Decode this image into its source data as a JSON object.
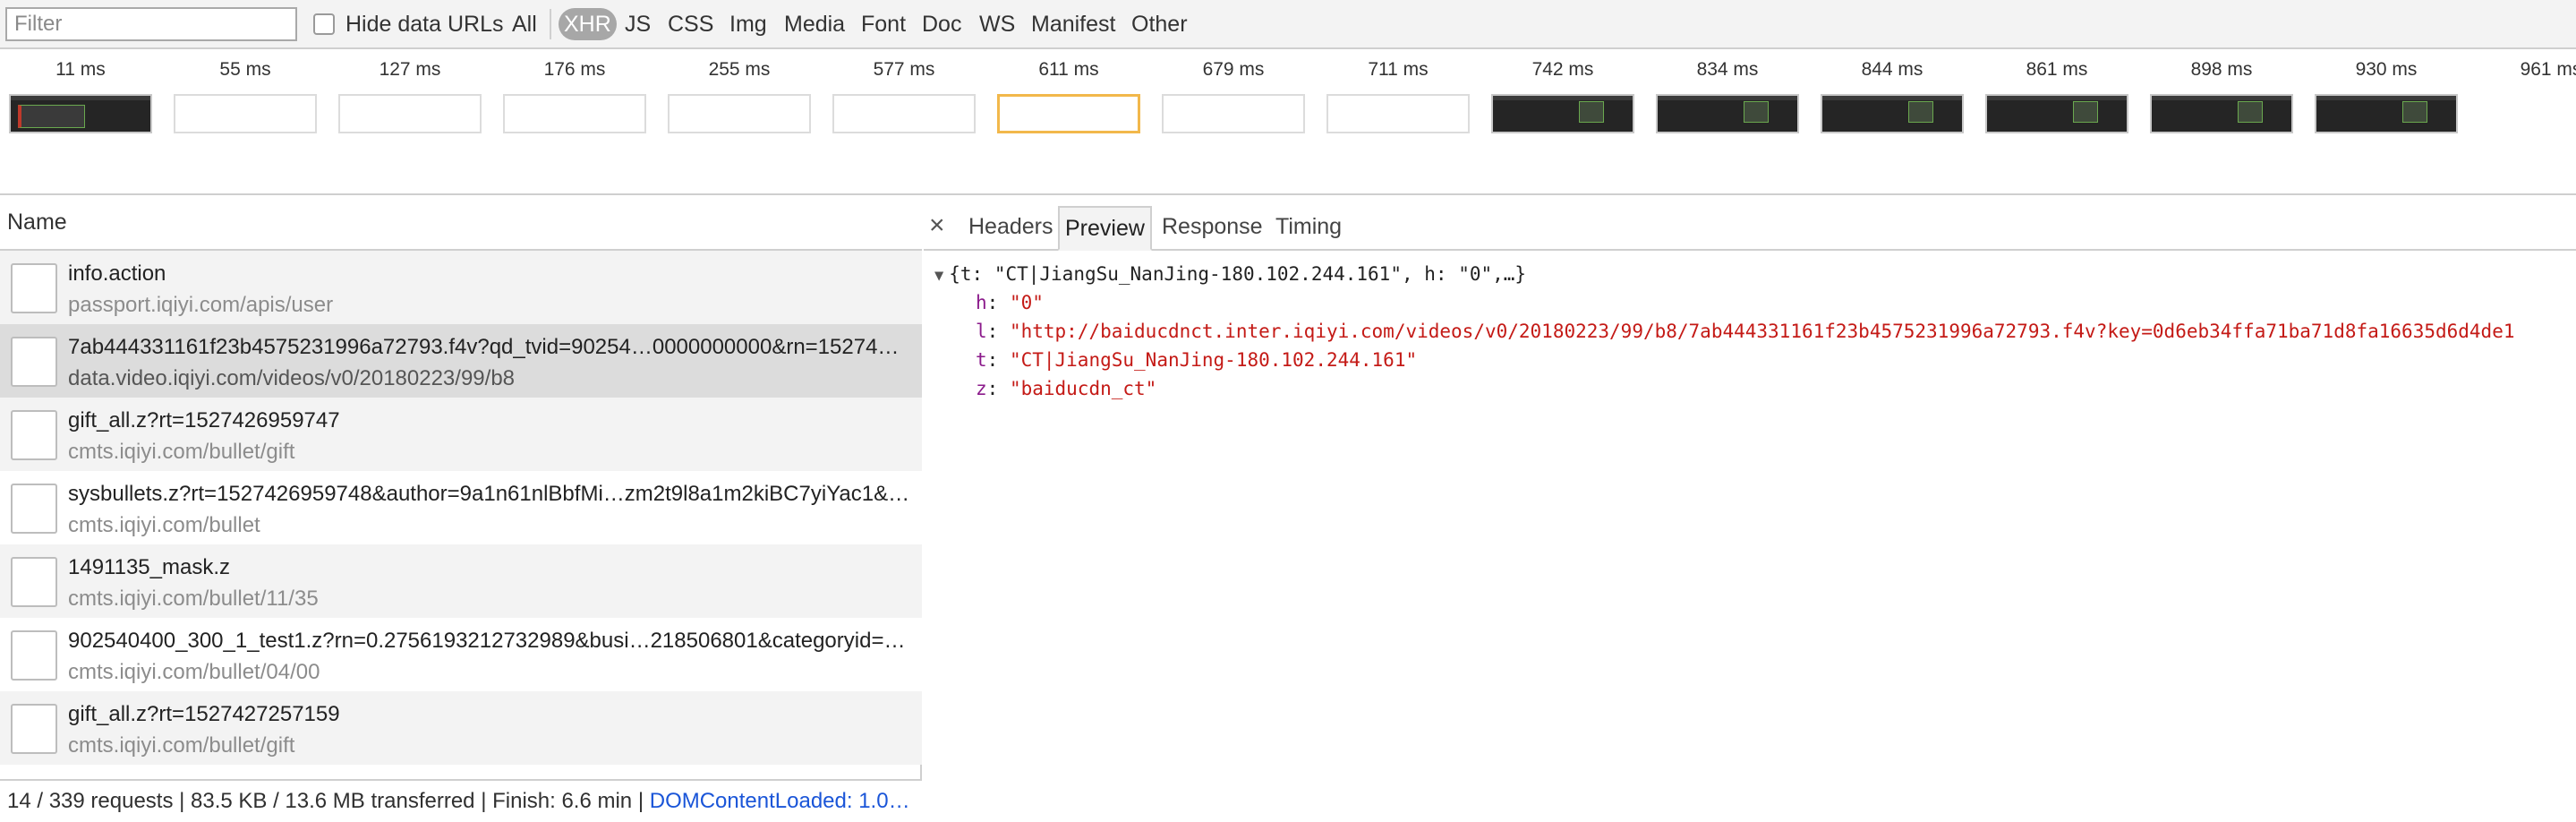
{
  "toolbar": {
    "filter_placeholder": "Filter",
    "hide_data_urls_label": "Hide data URLs",
    "types": [
      "All",
      "XHR",
      "JS",
      "CSS",
      "Img",
      "Media",
      "Font",
      "Doc",
      "WS",
      "Manifest",
      "Other"
    ],
    "active_type": "XHR"
  },
  "filmstrip": {
    "frames": [
      {
        "time": "11 ms",
        "thumb": "screenshot"
      },
      {
        "time": "55 ms",
        "thumb": "blank"
      },
      {
        "time": "127 ms",
        "thumb": "blank"
      },
      {
        "time": "176 ms",
        "thumb": "blank"
      },
      {
        "time": "255 ms",
        "thumb": "blank"
      },
      {
        "time": "577 ms",
        "thumb": "blank"
      },
      {
        "time": "611 ms",
        "thumb": "blank-selected"
      },
      {
        "time": "679 ms",
        "thumb": "blank"
      },
      {
        "time": "711 ms",
        "thumb": "blank"
      },
      {
        "time": "742 ms",
        "thumb": "screenshot"
      },
      {
        "time": "834 ms",
        "thumb": "screenshot"
      },
      {
        "time": "844 ms",
        "thumb": "screenshot"
      },
      {
        "time": "861 ms",
        "thumb": "screenshot"
      },
      {
        "time": "898 ms",
        "thumb": "screenshot"
      },
      {
        "time": "930 ms",
        "thumb": "screenshot"
      },
      {
        "time": "961 ms",
        "thumb": "screenshot"
      }
    ]
  },
  "request_list": {
    "header": "Name",
    "rows": [
      {
        "name": "info.action",
        "domain": "passport.iqiyi.com/apis/user"
      },
      {
        "name": "7ab444331161f23b4575231996a72793.f4v?qd_tvid=90254…0000000000&rn=15274…",
        "domain": "data.video.iqiyi.com/videos/v0/20180223/99/b8",
        "selected": true
      },
      {
        "name": "gift_all.z?rt=1527426959747",
        "domain": "cmts.iqiyi.com/bullet/gift"
      },
      {
        "name": "sysbullets.z?rt=1527426959748&author=9a1n61nlBbfMi…zm2t9l8a1m2kiBC7yiYac1&…",
        "domain": "cmts.iqiyi.com/bullet"
      },
      {
        "name": "1491135_mask.z",
        "domain": "cmts.iqiyi.com/bullet/11/35"
      },
      {
        "name": "902540400_300_1_test1.z?rn=0.2756193212732989&busi…218506801&categoryid=…",
        "domain": "cmts.iqiyi.com/bullet/04/00"
      },
      {
        "name": "gift_all.z?rt=1527427257159",
        "domain": "cmts.iqiyi.com/bullet/gift"
      }
    ]
  },
  "statusbar": {
    "summary": "14 / 339 requests | 83.5 KB / 13.6 MB transferred | Finish: 6.6 min | ",
    "dom_loaded": "DOMContentLoaded: 1.0…"
  },
  "details": {
    "close_glyph": "×",
    "tabs": [
      "Headers",
      "Preview",
      "Response",
      "Timing"
    ],
    "active_tab": "Preview",
    "preview": {
      "summary": "{t: \"CT|JiangSu_NanJing-180.102.244.161\", h: \"0\",…}",
      "properties": [
        {
          "key": "h",
          "value": "\"0\""
        },
        {
          "key": "l",
          "value": "\"http://baiducdnct.inter.iqiyi.com/videos/v0/20180223/99/b8/7ab444331161f23b4575231996a72793.f4v?key=0d6eb34ffa71ba71d8fa16635d6d4de1"
        },
        {
          "key": "t",
          "value": "\"CT|JiangSu_NanJing-180.102.244.161\""
        },
        {
          "key": "z",
          "value": "\"baiducdn_ct\""
        }
      ]
    }
  }
}
